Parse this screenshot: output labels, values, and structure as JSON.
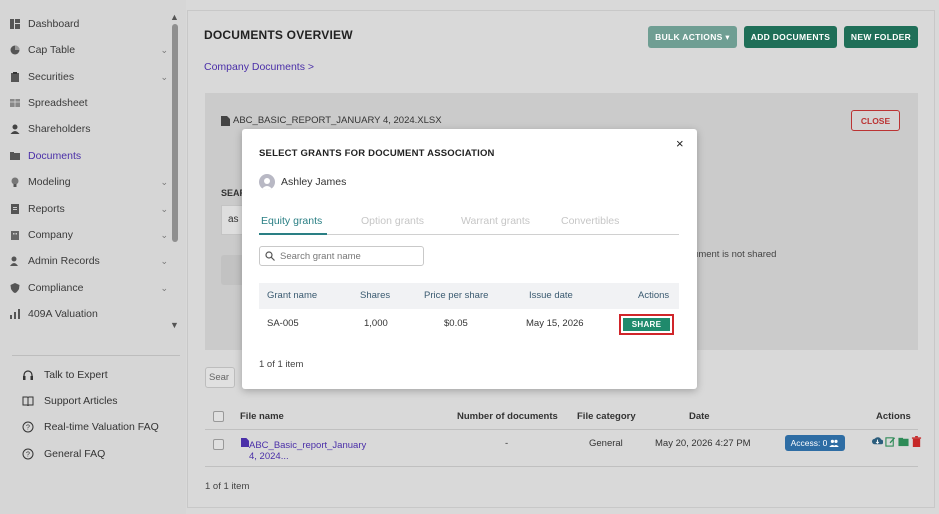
{
  "sidebar": {
    "items": [
      {
        "label": "Dashboard",
        "icon": "dashboard-icon",
        "has_chevron": false
      },
      {
        "label": "Cap Table",
        "icon": "pie-chart-icon",
        "has_chevron": true
      },
      {
        "label": "Securities",
        "icon": "clipboard-icon",
        "has_chevron": true
      },
      {
        "label": "Spreadsheet",
        "icon": "spreadsheet-icon",
        "has_chevron": false
      },
      {
        "label": "Shareholders",
        "icon": "person-icon",
        "has_chevron": false
      },
      {
        "label": "Documents",
        "icon": "folder-icon",
        "has_chevron": false,
        "active": true
      },
      {
        "label": "Modeling",
        "icon": "bulb-icon",
        "has_chevron": true
      },
      {
        "label": "Reports",
        "icon": "report-icon",
        "has_chevron": true
      },
      {
        "label": "Company",
        "icon": "building-icon",
        "has_chevron": true
      },
      {
        "label": "Admin Records",
        "icon": "admin-icon",
        "has_chevron": true
      },
      {
        "label": "Compliance",
        "icon": "shield-icon",
        "has_chevron": true
      },
      {
        "label": "409A Valuation",
        "icon": "valuation-icon",
        "has_chevron": false
      }
    ],
    "chevron_glyph": "⌄",
    "help": [
      {
        "label": "Talk to Expert",
        "icon": "headset-icon"
      },
      {
        "label": "Support Articles",
        "icon": "book-icon"
      },
      {
        "label": "Real-time Valuation FAQ",
        "icon": "help-circle-icon"
      },
      {
        "label": "General FAQ",
        "icon": "help-circle-icon"
      }
    ]
  },
  "header": {
    "title": "DOCUMENTS OVERVIEW",
    "bulk_actions": "BULK ACTIONS ▾",
    "add_documents": "ADD DOCUMENTS",
    "new_folder": "NEW FOLDER",
    "breadcrumb": "Company Documents  >"
  },
  "panel": {
    "file_name": "ABC_BASIC_REPORT_JANUARY 4, 2024.XLSX",
    "close_label": "CLOSE",
    "search_label": "SEAR",
    "input_value": "as",
    "not_shared_text": "ocument is not shared"
  },
  "files": {
    "search_placeholder": "Sear",
    "columns": [
      "File name",
      "Number of documents",
      "File category",
      "Date",
      "Actions"
    ],
    "rows": [
      {
        "file_name": "ABC_Basic_report_January 4, 2024...",
        "number_of_documents": "-",
        "category": "General",
        "date": "May 20, 2026 4:27 PM",
        "access": "Access: 0"
      }
    ],
    "pager": "1 of 1 item"
  },
  "modal": {
    "title": "SELECT GRANTS FOR DOCUMENT ASSOCIATION",
    "close_glyph": "×",
    "user_name": "Ashley James",
    "tabs": [
      "Equity grants",
      "Option grants",
      "Warrant grants",
      "Convertibles"
    ],
    "search_placeholder": "Search grant name",
    "columns": [
      "Grant name",
      "Shares",
      "Price per share",
      "Issue date",
      "Actions"
    ],
    "rows": [
      {
        "grant_name": "SA-005",
        "shares": "1,000",
        "price": "$0.05",
        "issue_date": "May 15, 2026",
        "action": "SHARE"
      }
    ],
    "pager": "1 of 1 item"
  },
  "colors": {
    "accent_purple": "#4a2fa8",
    "primary_green": "#1f6f58",
    "share_green": "#1f8a6c",
    "tab_teal": "#2a7f84",
    "highlight_red": "#d0252a",
    "access_blue": "#2e6da4"
  }
}
